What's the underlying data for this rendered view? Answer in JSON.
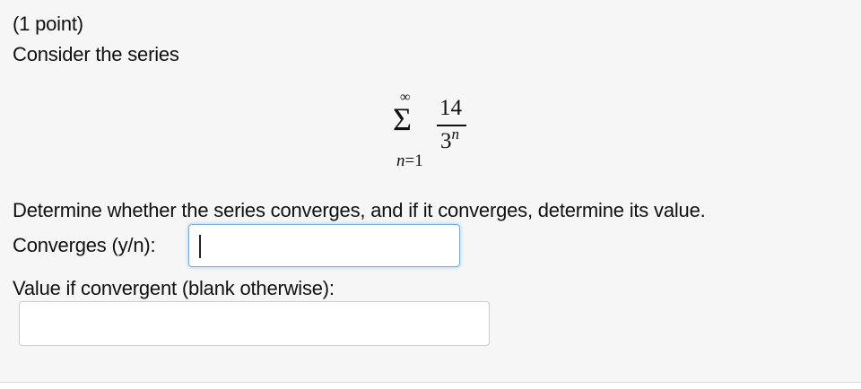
{
  "problem": {
    "points": "(1 point)",
    "prompt": "Consider the series",
    "formula": {
      "summation_symbol": "Σ",
      "upper_limit": "∞",
      "index_variable": "n",
      "lower_limit_equals": "=1",
      "numerator": "14",
      "denominator_base": "3",
      "denominator_exponent": "n"
    },
    "question": "Determine whether the series converges, and if it converges, determine its value."
  },
  "fields": {
    "converges": {
      "label": "Converges (y/n):",
      "value": ""
    },
    "value": {
      "label": "Value if convergent (blank otherwise):",
      "value": ""
    }
  },
  "colors": {
    "panel_background": "#f6f6f6",
    "focus_border": "#79a9d8",
    "input_border": "#cccccc"
  }
}
